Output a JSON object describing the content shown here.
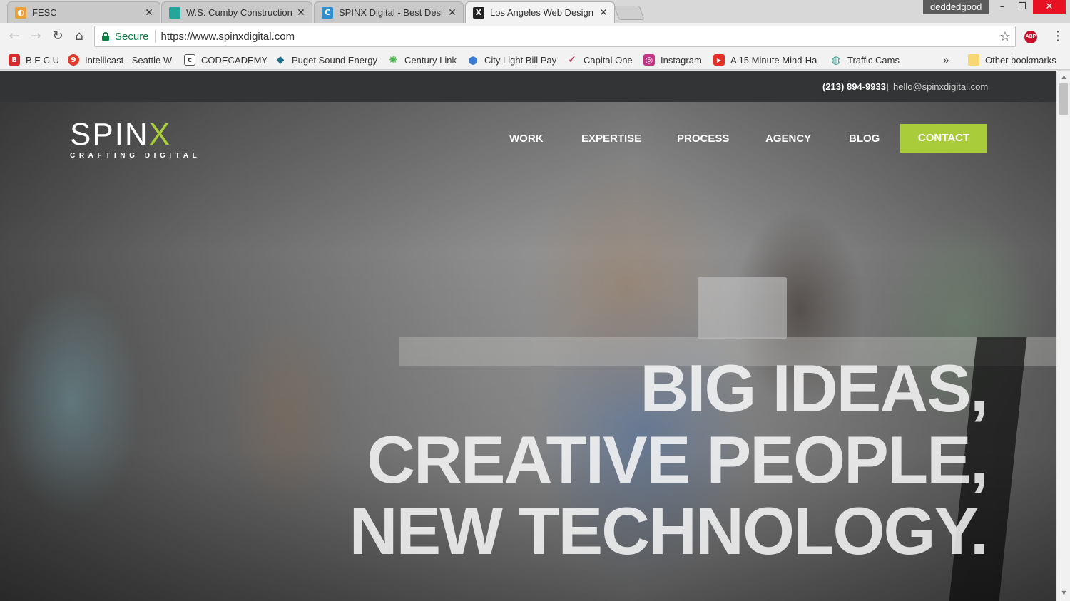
{
  "browser": {
    "tabs": [
      {
        "title": "FESC",
        "icon": "fesc-favicon",
        "color": "#e8a13a"
      },
      {
        "title": "W.S. Cumby Construction",
        "icon": "cumby-favicon",
        "color": "#26a69a"
      },
      {
        "title": "SPINX Digital - Best Desi",
        "icon": "spinx-favicon",
        "color": "#2f8fd0"
      },
      {
        "title": "Los Angeles Web Design",
        "icon": "spinx-x-favicon",
        "color": "#222222"
      }
    ],
    "profile": "deddedgood",
    "security_label": "Secure",
    "url": "https://www.spinxdigital.com",
    "abp_label": "ABP",
    "bookmarks": [
      {
        "label": "B E C U",
        "icon": "becu-icon",
        "color": "#d62b2b",
        "glyph": "B"
      },
      {
        "label": "Intellicast - Seattle W",
        "icon": "intellicast-icon",
        "color": "#e23b2a",
        "glyph": "9"
      },
      {
        "label": "CODECADEMY",
        "icon": "codecademy-icon",
        "color": "#555555",
        "glyph": "c"
      },
      {
        "label": "Puget Sound Energy",
        "icon": "pse-icon",
        "color": "#1f6f8b",
        "glyph": "◆"
      },
      {
        "label": "Century Link",
        "icon": "centurylink-icon",
        "color": "#4cae4c",
        "glyph": "✺"
      },
      {
        "label": "City Light Bill Pay",
        "icon": "globe-icon",
        "color": "#3b7bd4",
        "glyph": "●"
      },
      {
        "label": "Capital One",
        "icon": "capitalone-icon",
        "color": "#c8102e",
        "glyph": "✓"
      },
      {
        "label": "Instagram",
        "icon": "instagram-icon",
        "color": "#c13584",
        "glyph": "◎"
      },
      {
        "label": "A 15 Minute Mind-Ha",
        "icon": "youtube-icon",
        "color": "#e52d27",
        "glyph": "▶"
      },
      {
        "label": "Traffic Cams",
        "icon": "traffic-icon",
        "color": "#2a9d8f",
        "glyph": "◍"
      }
    ],
    "overflow": "»",
    "other_bookmarks": "Other bookmarks"
  },
  "site": {
    "phone": "(213) 894-9933",
    "divider": "|",
    "email": "hello@spinxdigital.com",
    "logo": {
      "word_main": "SPIN",
      "word_accent": "X",
      "tagline": "CRAFTING DIGITAL"
    },
    "nav": [
      "WORK",
      "EXPERTISE",
      "PROCESS",
      "AGENCY",
      "BLOG"
    ],
    "contact": "CONTACT",
    "headline": [
      "BIG IDEAS,",
      "CREATIVE PEOPLE,",
      "NEW TECHNOLOGY."
    ],
    "accent_color": "#a9cc3b"
  }
}
